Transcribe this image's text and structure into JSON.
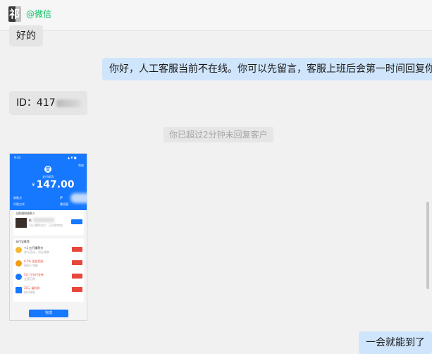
{
  "header": {
    "avatar_glyph": "祁",
    "source_label": "@微信"
  },
  "messages": {
    "m1": "好的",
    "m2": "你好，人工客服当前不在线。你可以先留言，客服上班后会第一时间回复你。",
    "m3_prefix": "ID：417",
    "m4": "一会就能到了"
  },
  "system_notice": "你已超过2分钟未回复客户",
  "payment_screenshot": {
    "status_left": "9:30",
    "status_right": "▲ ▼ ■",
    "top_done": "完成",
    "paid_label": "支付成功",
    "currency": "¥",
    "amount": "147.00",
    "row1_left": "收款方",
    "row1_right": "萨",
    "row2_left": "付款方式",
    "row2_right": "建设银",
    "card1_title": "立即通知收款人",
    "card1_name": "影",
    "card1_desc": "可以通知对方：已付款完成",
    "card2_title": "支付宝推荐",
    "ads": [
      {
        "title": "+1 五行福积分",
        "sub": "参与活动，点击领取",
        "color": "#f5b82e"
      },
      {
        "title": "0.5% 现金奖励",
        "sub": "每周三领取",
        "color": "#f39c12"
      },
      {
        "title": "5元 打车代金券",
        "sub": "全国可用",
        "color": "#1677ff"
      },
      {
        "title": "20元 福利券",
        "sub": "限时领取",
        "color": "#1677ff"
      }
    ],
    "done_button": "完成"
  }
}
